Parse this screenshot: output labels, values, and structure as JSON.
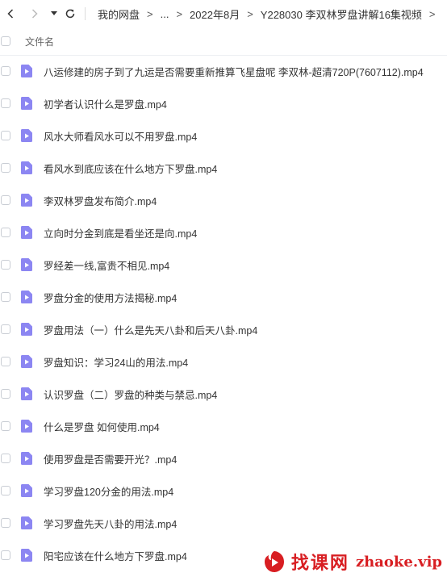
{
  "breadcrumbs": [
    "我的网盘",
    "...",
    "2022年8月",
    "Y228030 李双林罗盘讲解16集视频"
  ],
  "separator": ">",
  "list_header": "文件名",
  "files": [
    "八运修建的房子到了九运是否需要重新推算飞星盘呢 李双林-超清720P(7607112).mp4",
    "初学者认识什么是罗盘.mp4",
    "风水大师看风水可以不用罗盘.mp4",
    "看风水到底应该在什么地方下罗盘.mp4",
    "李双林罗盘发布简介.mp4",
    "立向时分金到底是看坐还是向.mp4",
    "罗经差一线,富贵不相见.mp4",
    "罗盘分金的使用方法揭秘.mp4",
    "罗盘用法（一）什么是先天八卦和后天八卦.mp4",
    "罗盘知识：学习24山的用法.mp4",
    "认识罗盘（二）罗盘的种类与禁忌.mp4",
    "什么是罗盘 如何使用.mp4",
    "使用罗盘是否需要开光？.mp4",
    "学习罗盘120分金的用法.mp4",
    "学习罗盘先天八卦的用法.mp4",
    "阳宅应该在什么地方下罗盘.mp4"
  ],
  "watermark": {
    "cn": "找课网",
    "en": "zhaoke.vip"
  },
  "colors": {
    "file_icon": "#8c86f2",
    "watermark": "#d81e22"
  }
}
